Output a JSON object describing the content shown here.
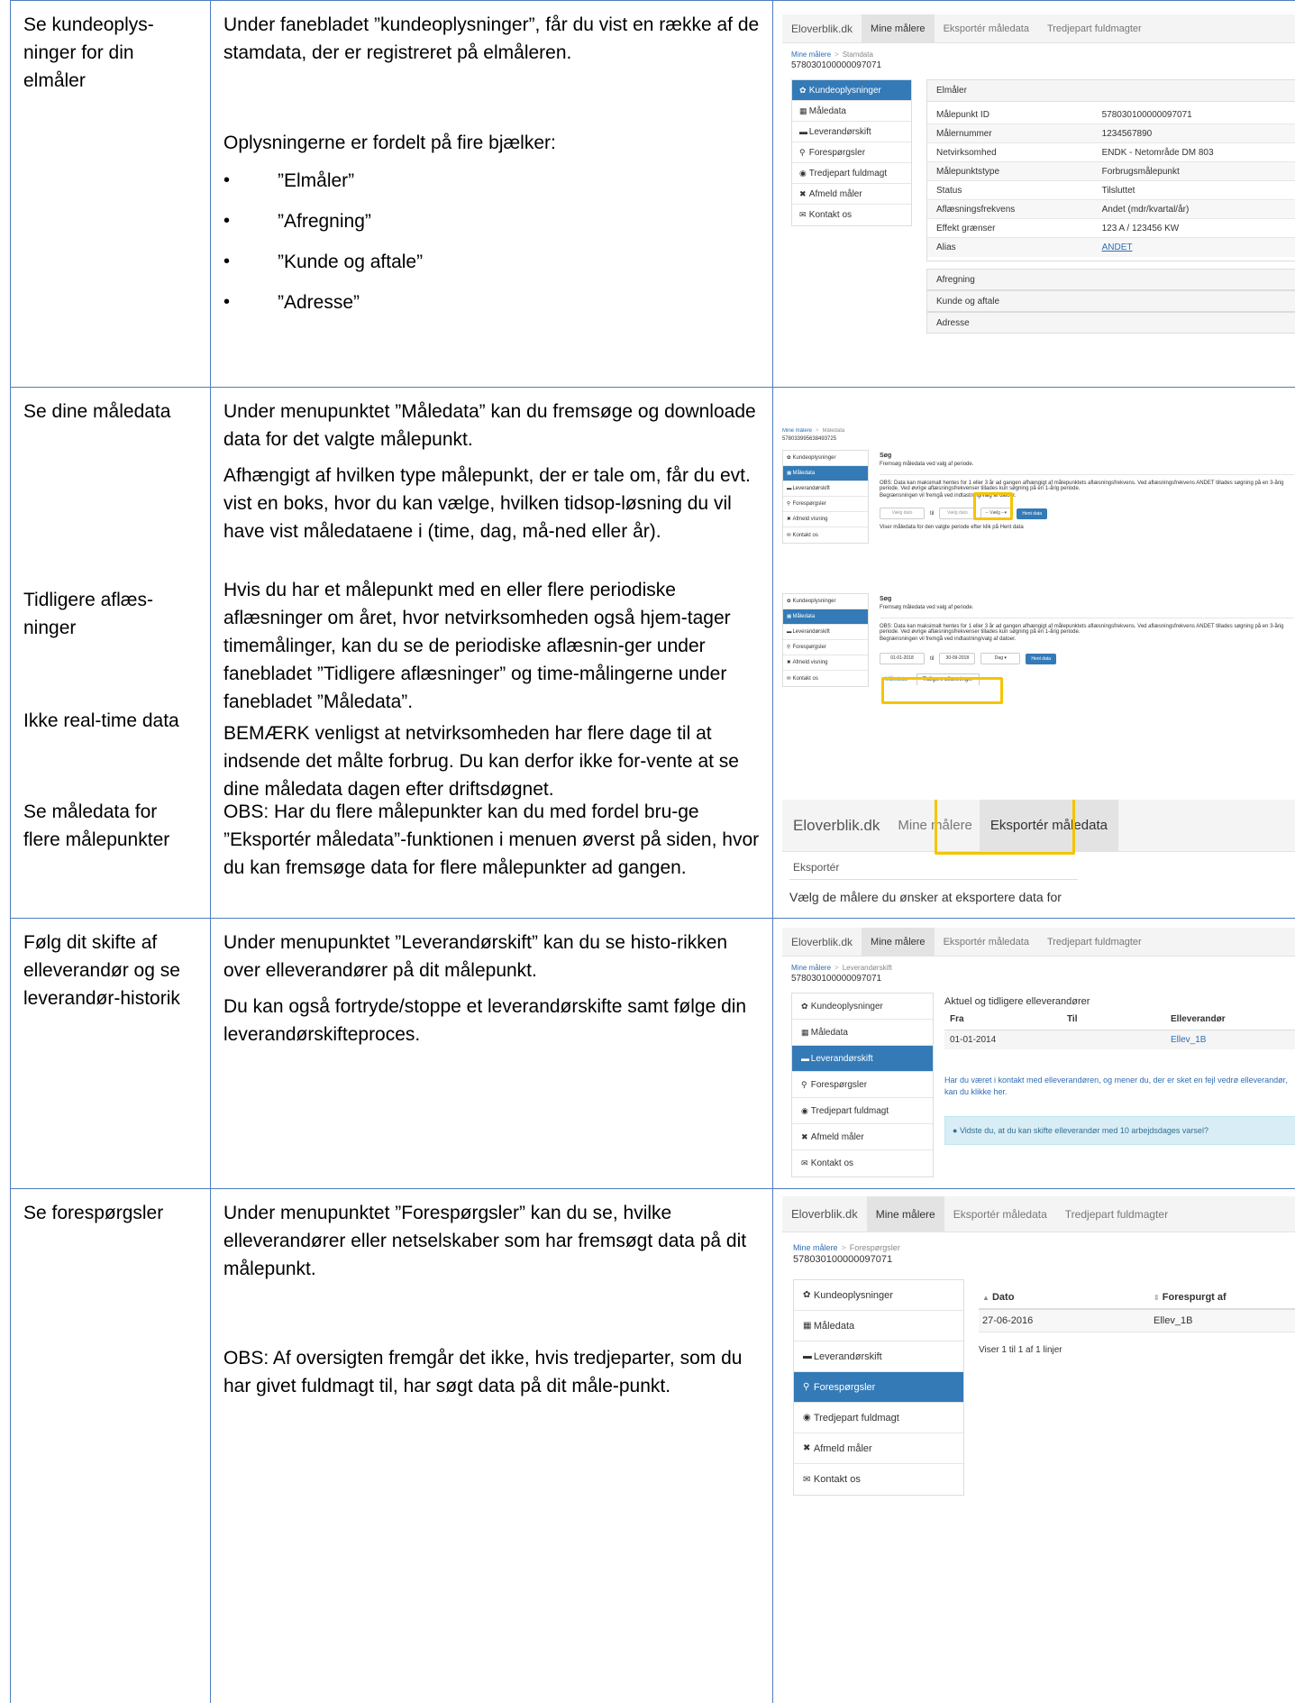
{
  "rows": [
    {
      "label": "Se kundeoplys-ninger for din elmåler",
      "texts": [
        "Under fanebladet ”kundeoplysninger”, får du vist en række af de stamdata, der er registreret på elmåleren.",
        "Oplysningerne er fordelt på fire bjælker:"
      ],
      "bullets": [
        "”Elmåler”",
        "”Afregning”",
        "”Kunde og aftale”",
        "”Adresse”"
      ]
    },
    {
      "label": "Se dine måledata",
      "texts": [
        "Under menupunktet ”Måledata” kan du fremsøge og downloade data for det valgte målepunkt.",
        "Afhængigt af hvilken type målepunkt, der er tale om, får du evt. vist en boks, hvor du kan vælge, hvilken tidsop-løsning du vil have vist måledataene i (time, dag, må-ned eller år)."
      ]
    },
    {
      "label": "Tidligere aflæs-ninger",
      "texts": [
        "Hvis du har et målepunkt med en eller flere periodiske aflæsninger om året, hvor netvirksomheden også hjem-tager timemålinger, kan du se de periodiske aflæsnin-ger under fanebladet ”Tidligere aflæsninger” og time-målingerne under fanebladet ”Måledata”."
      ]
    },
    {
      "label": "Ikke real-time data",
      "texts": [
        "BEMÆRK venligst at netvirksomheden har flere dage til at indsende det målte forbrug. Du kan derfor ikke for-vente at se dine måledata dagen efter driftsdøgnet."
      ]
    },
    {
      "label": "Se måledata for flere målepunkter",
      "texts": [
        "OBS: Har du flere målepunkter kan du med fordel bru-ge ”Eksportér måledata”-funktionen i menuen øverst på siden, hvor du kan fremsøge data for flere målepunkter ad gangen."
      ]
    },
    {
      "label": "Følg dit skifte af elleverandør og se leverandør-historik",
      "texts": [
        "Under menupunktet ”Leverandørskift” kan du se histo-rikken over elleverandører på dit målepunkt.",
        "Du kan også fortryde/stoppe et leverandørskifte samt følge din leverandørskifteproces."
      ]
    },
    {
      "label": "Se forespørgsler",
      "texts": [
        "Under menupunktet ”Forespørgsler” kan du se, hvilke elleverandører eller netselskaber som har fremsøgt data på dit målepunkt.",
        "OBS: Af oversigten fremgår det ikke, hvis tredjeparter, som du har givet fuldmagt til, har søgt data på dit måle-punkt."
      ]
    }
  ],
  "nav": {
    "brand": "Eloverblik.dk",
    "mine": "Mine målere",
    "export": "Eksportér måledata",
    "third": "Tredjepart fuldmagter"
  },
  "breadcrumb_root": "Mine målere",
  "meter_id": "578030100000097071",
  "meter_id_2": "578033995638493725",
  "menu": {
    "kunde": "Kundeoplysninger",
    "maaledata": "Måledata",
    "lev": "Leverandørskift",
    "fore": "Forespørgsler",
    "tred": "Tredjepart fuldmagt",
    "afmeld": "Afmeld måler",
    "afmeld_visning": "Afmeld visning",
    "kontakt": "Kontakt os"
  },
  "shot1": {
    "crumb": "Stamdata",
    "panel_title": "Elmåler",
    "rows": [
      {
        "k": "Målepunkt ID",
        "v": "578030100000097071"
      },
      {
        "k": "Målernummer",
        "v": "1234567890"
      },
      {
        "k": "Netvirksomhed",
        "v": "ENDK - Netområde DM 803"
      },
      {
        "k": "Målepunktstype",
        "v": "Forbrugsmålepunkt"
      },
      {
        "k": "Status",
        "v": "Tilsluttet"
      },
      {
        "k": "Aflæsningsfrekvens",
        "v": "Andet (mdr/kvartal/år)"
      },
      {
        "k": "Effekt grænser",
        "v": "123 A / 123456 KW"
      },
      {
        "k": "Alias",
        "v": "ANDET"
      }
    ],
    "collapsed": [
      "Afregning",
      "Kunde og aftale",
      "Adresse"
    ]
  },
  "shot2": {
    "crumb": "Måledata",
    "title": "Søg",
    "sub": "Fremsøg måledata ved valg af periode.",
    "obs": "OBS: Data kan maksimalt hentes for 1 eller 3 år ad gangen afhængigt af målepunktets aflæsningsfrekvens. Ved aflæsningsfrekvens ANDET tillades søgning på en 3-årig periode. Ved øvrige aflæsningsfrekvenser tillades kun søgning på en 1-årig periode.",
    "note": "Begrænsningen vil fremgå ved indtastning/valg af datoer.",
    "from_ph": "Vælg dato",
    "til": "til",
    "to_ph": "Vælg dato",
    "select": "-- Vælg --",
    "btn": "Hent data",
    "footer": "Viser måledata for den valgte periode efter klik på Hent data"
  },
  "shot3": {
    "title": "Søg",
    "sub": "Fremsøg måledata ved valg af periode.",
    "from": "01-01-2018",
    "til": "til",
    "to": "30-09-2018",
    "select": "Dag",
    "btn": "Hent data",
    "tab1": "Måledata",
    "tab2": "Tidligere aflæsninger"
  },
  "shot4": {
    "tab": "Eksportér",
    "text": "Vælg de målere du ønsker at eksportere data for"
  },
  "shot5": {
    "crumb": "Leverandørskift",
    "title": "Aktuel og tidligere elleverandører",
    "cols": [
      "Fra",
      "Til",
      "Elleverandør"
    ],
    "row": [
      "01-01-2014",
      "",
      "Ellev_1B"
    ],
    "link": "Har du været i kontakt med elleverandøren, og mener du, der er sket en fejl vedrø elleverandør, kan du klikke her.",
    "info": "Vidste du, at du kan skifte elleverandør med 10 arbejdsdages varsel?"
  },
  "shot6": {
    "crumb": "Forespørgsler",
    "cols": [
      "Dato",
      "Forespurgt af"
    ],
    "row": [
      "27-06-2016",
      "Ellev_1B"
    ],
    "count": "Viser 1 til 1 af 1 linjer"
  }
}
